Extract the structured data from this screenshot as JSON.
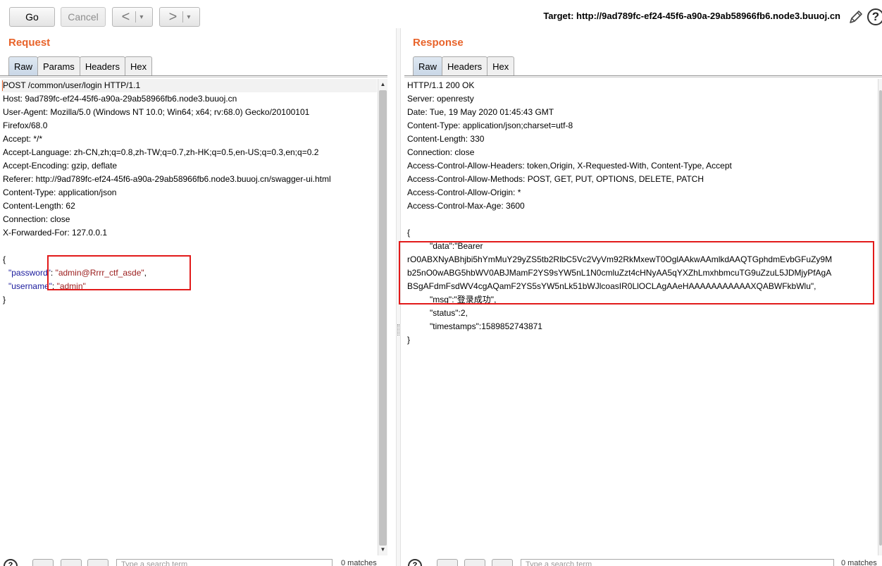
{
  "toolbar": {
    "go_label": "Go",
    "cancel_label": "Cancel",
    "back_arrow": "<",
    "forward_arrow": ">",
    "dropdown_glyph": "▾",
    "target_label": "Target: http://9ad789fc-ef24-45f6-a90a-29ab58966fb6.node3.buuoj.cn",
    "help_glyph": "?"
  },
  "request": {
    "title": "Request",
    "tabs": [
      "Raw",
      "Params",
      "Headers",
      "Hex"
    ],
    "active_tab": "Raw",
    "headers": [
      "POST /common/user/login HTTP/1.1",
      "Host: 9ad789fc-ef24-45f6-a90a-29ab58966fb6.node3.buuoj.cn",
      "User-Agent: Mozilla/5.0 (Windows NT 10.0; Win64; x64; rv:68.0) Gecko/20100101",
      "Firefox/68.0",
      "Accept: */*",
      "Accept-Language: zh-CN,zh;q=0.8,zh-TW;q=0.7,zh-HK;q=0.5,en-US;q=0.3,en;q=0.2",
      "Accept-Encoding: gzip, deflate",
      "Referer: http://9ad789fc-ef24-45f6-a90a-29ab58966fb6.node3.buuoj.cn/swagger-ui.html",
      "Content-Type: application/json",
      "Content-Length: 62",
      "Connection: close",
      "X-Forwarded-For: 127.0.0.1"
    ],
    "body": {
      "open": "{",
      "password_key": "\"password\"",
      "password_value": "\"admin@Rrrr_ctf_asde\"",
      "username_key": "\"username\"",
      "username_value": "\"admin\"",
      "close": "}"
    }
  },
  "response": {
    "title": "Response",
    "tabs": [
      "Raw",
      "Headers",
      "Hex"
    ],
    "active_tab": "Raw",
    "headers": [
      "HTTP/1.1 200 OK",
      "Server: openresty",
      "Date: Tue, 19 May 2020 01:45:43 GMT",
      "Content-Type: application/json;charset=utf-8",
      "Content-Length: 330",
      "Connection: close",
      "Access-Control-Allow-Headers: token,Origin, X-Requested-With, Content-Type, Accept",
      "Access-Control-Allow-Methods: POST, GET, PUT, OPTIONS, DELETE, PATCH",
      "Access-Control-Allow-Origin: *",
      "Access-Control-Max-Age: 3600"
    ],
    "body": {
      "open": "{",
      "data_key": "\"data\"",
      "data_value_start": "\"Bearer",
      "data_lines": [
        "rO0ABXNyABhjbi5hYmMuY29yZS5tb2RlbC5Vc2VyVm92RkMxewT0OglAAkwAAmlkdAAQTGphdmEvbGFuZy9M",
        "b25nO0wABG5hbWV0ABJMamF2YS9sYW5nL1N0cmluZzt4cHNyAA5qYXZhLmxhbmcuTG9uZzuL5JDMjyPfAgA",
        "BSgAFdmFsdWV4cgAQamF2YS5sYW5nLk51bWJlcoasIR0LlOCLAgAAeHAAAAAAAAAAAXQABWFkbWlu\","
      ],
      "msg_key": "\"msg\"",
      "msg_value": "\"登录成功\",",
      "status_key": "\"status\"",
      "status_value": "2,",
      "timestamps_key": "\"timestamps\"",
      "timestamps_value": "1589852743871",
      "close": "}"
    }
  },
  "bottom": {
    "help_glyph": "?",
    "search_placeholder": "Type a search term",
    "matches": "0 matches"
  },
  "colors": {
    "section_title": "#e8632a",
    "highlight_box": "#e21a1a",
    "json_key": "#1a1a9c",
    "json_string": "#9a1b1b"
  }
}
